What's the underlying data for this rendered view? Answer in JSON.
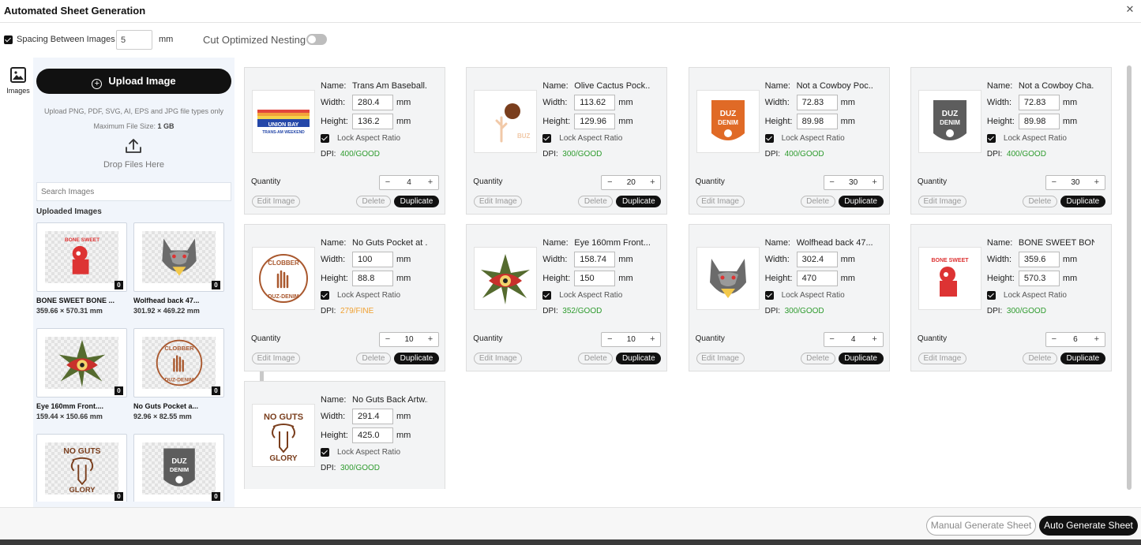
{
  "window": {
    "title": "Automated Sheet Generation",
    "close_symbol": "✕"
  },
  "options": {
    "spacing_label": "Spacing Between Images",
    "spacing_value": "5",
    "spacing_unit": "mm",
    "spacing_checked": true,
    "nesting_label": "Cut Optimized Nesting",
    "nesting_on": false
  },
  "rail": {
    "images_label": "Images",
    "icon": "image-icon"
  },
  "sidebar": {
    "upload_label": "Upload Image",
    "upload_icon": "plus-circle-icon",
    "supported_text": "Upload PNG, PDF, SVG, AI, EPS and JPG file types only",
    "max_size_label": "Maximum File Size:",
    "max_size_value": "1 GB",
    "drop_label": "Drop Files Here",
    "drop_icon": "upload-icon",
    "search_placeholder": "Search Images",
    "uploaded_heading": "Uploaded Images",
    "uploaded": [
      {
        "name": "BONE SWEET BONE ...",
        "size": "359.66 × 570.31 mm",
        "count": "0",
        "art": "bone"
      },
      {
        "name": "Wolfhead back 47...",
        "size": "301.92 × 469.22 mm",
        "count": "0",
        "art": "wolf"
      },
      {
        "name": "Eye 160mm Front....",
        "size": "159.44 × 150.66 mm",
        "count": "0",
        "art": "eye"
      },
      {
        "name": "No Guts Pocket a...",
        "size": "92.96 × 82.55 mm",
        "count": "0",
        "art": "clobber"
      },
      {
        "name": "",
        "size": "",
        "count": "0",
        "art": "noguts"
      },
      {
        "name": "",
        "size": "",
        "count": "0",
        "art": "duzgray"
      }
    ]
  },
  "labels": {
    "name": "Name:",
    "width": "Width:",
    "height": "Height:",
    "unit": "mm",
    "lock": "Lock Aspect Ratio",
    "dpi": "DPI:",
    "quantity": "Quantity",
    "edit": "Edit Image",
    "delete": "Delete",
    "duplicate": "Duplicate",
    "minus": "−",
    "plus": "+"
  },
  "cards": [
    {
      "name": "Trans Am Baseball...",
      "width": "280.4",
      "height": "136.2",
      "dpi": "400/GOOD",
      "dpi_color": "#2e9b2e",
      "quantity": "4",
      "art": "transam"
    },
    {
      "name": "Olive Cactus Pock...",
      "width": "113.62",
      "height": "129.96",
      "dpi": "300/GOOD",
      "dpi_color": "#2e9b2e",
      "quantity": "20",
      "art": "cactus"
    },
    {
      "name": "Not a Cowboy Poc...",
      "width": "72.83",
      "height": "89.98",
      "dpi": "400/GOOD",
      "dpi_color": "#2e9b2e",
      "quantity": "30",
      "art": "duzorange"
    },
    {
      "name": "Not a Cowboy Cha...",
      "width": "72.83",
      "height": "89.98",
      "dpi": "400/GOOD",
      "dpi_color": "#2e9b2e",
      "quantity": "30",
      "art": "duzgray"
    },
    {
      "name": "No Guts Pocket at ...",
      "width": "100",
      "height": "88.8",
      "dpi": "279/FINE",
      "dpi_color": "#f0a030",
      "quantity": "10",
      "art": "clobber"
    },
    {
      "name": "Eye 160mm Front....",
      "width": "158.74",
      "height": "150",
      "dpi": "352/GOOD",
      "dpi_color": "#2e9b2e",
      "quantity": "10",
      "art": "eye"
    },
    {
      "name": "Wolfhead back 47...",
      "width": "302.4",
      "height": "470",
      "dpi": "300/GOOD",
      "dpi_color": "#2e9b2e",
      "quantity": "4",
      "art": "wolf"
    },
    {
      "name": "BONE SWEET BON...",
      "width": "359.6",
      "height": "570.3",
      "dpi": "300/GOOD",
      "dpi_color": "#2e9b2e",
      "quantity": "6",
      "art": "bone"
    },
    {
      "name": "No Guts Back Artw...",
      "width": "291.4",
      "height": "425.0",
      "dpi": "300/GOOD",
      "dpi_color": "#2e9b2e",
      "quantity": "",
      "art": "noguts"
    }
  ],
  "footer": {
    "manual_label": "Manual Generate Sheet",
    "auto_label": "Auto Generate Sheet"
  }
}
